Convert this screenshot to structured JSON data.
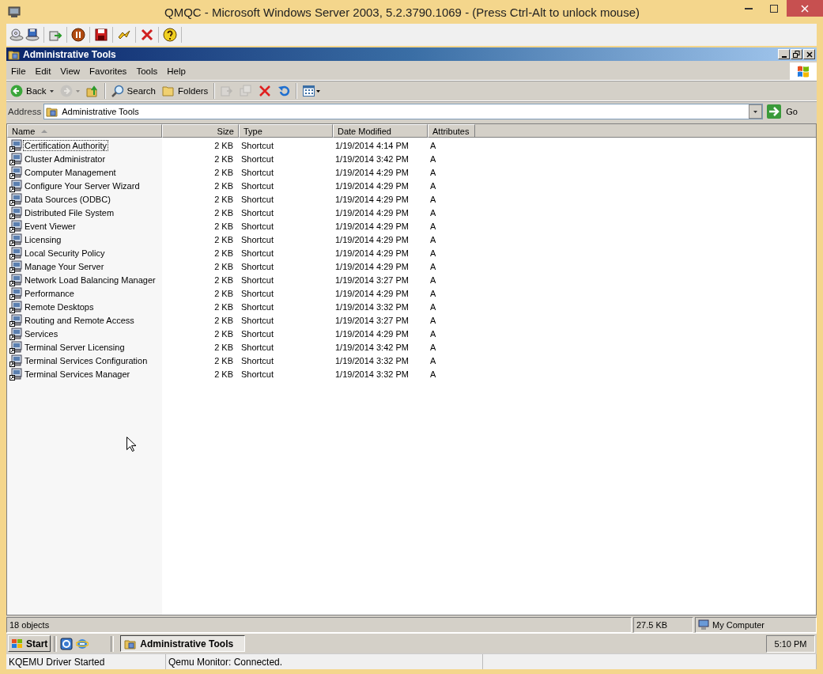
{
  "host_window": {
    "title": "QMQC - Microsoft Windows Server 2003, 5.2.3790.1069 - (Press Ctrl-Alt to unlock mouse)"
  },
  "explorer": {
    "title": "Administrative Tools",
    "menu": [
      {
        "label": "File"
      },
      {
        "label": "Edit"
      },
      {
        "label": "View"
      },
      {
        "label": "Favorites"
      },
      {
        "label": "Tools"
      },
      {
        "label": "Help"
      }
    ],
    "toolbar": [
      {
        "kind": "back",
        "label": "Back",
        "disabled": false
      },
      {
        "kind": "forward",
        "disabled": true
      },
      {
        "kind": "up",
        "disabled": false
      },
      {
        "kind": "separator"
      },
      {
        "kind": "search",
        "label": "Search",
        "disabled": false
      },
      {
        "kind": "folders",
        "label": "Folders",
        "disabled": false
      },
      {
        "kind": "separator"
      },
      {
        "kind": "move",
        "disabled": true
      },
      {
        "kind": "copy",
        "disabled": true
      },
      {
        "kind": "delete",
        "disabled": false
      },
      {
        "kind": "undo",
        "disabled": false
      },
      {
        "kind": "separator"
      },
      {
        "kind": "views",
        "disabled": false
      }
    ],
    "address": {
      "label": "Address",
      "value": "Administrative Tools",
      "go": "Go"
    },
    "columns": [
      {
        "label": "Name",
        "sorted": true
      },
      {
        "label": "Size",
        "sorted": false
      },
      {
        "label": "Type",
        "sorted": false
      },
      {
        "label": "Date Modified",
        "sorted": false
      },
      {
        "label": "Attributes",
        "sorted": false
      }
    ],
    "rows": [
      {
        "name": "Certification Authority",
        "size": "2 KB",
        "type": "Shortcut",
        "date": "1/19/2014 4:14 PM",
        "attributes": "A",
        "focused": true
      },
      {
        "name": "Cluster Administrator",
        "size": "2 KB",
        "type": "Shortcut",
        "date": "1/19/2014 3:42 PM",
        "attributes": "A",
        "focused": false
      },
      {
        "name": "Computer Management",
        "size": "2 KB",
        "type": "Shortcut",
        "date": "1/19/2014 4:29 PM",
        "attributes": "A",
        "focused": false
      },
      {
        "name": "Configure Your Server Wizard",
        "size": "2 KB",
        "type": "Shortcut",
        "date": "1/19/2014 4:29 PM",
        "attributes": "A",
        "focused": false
      },
      {
        "name": "Data Sources (ODBC)",
        "size": "2 KB",
        "type": "Shortcut",
        "date": "1/19/2014 4:29 PM",
        "attributes": "A",
        "focused": false
      },
      {
        "name": "Distributed File System",
        "size": "2 KB",
        "type": "Shortcut",
        "date": "1/19/2014 4:29 PM",
        "attributes": "A",
        "focused": false
      },
      {
        "name": "Event Viewer",
        "size": "2 KB",
        "type": "Shortcut",
        "date": "1/19/2014 4:29 PM",
        "attributes": "A",
        "focused": false
      },
      {
        "name": "Licensing",
        "size": "2 KB",
        "type": "Shortcut",
        "date": "1/19/2014 4:29 PM",
        "attributes": "A",
        "focused": false
      },
      {
        "name": "Local Security Policy",
        "size": "2 KB",
        "type": "Shortcut",
        "date": "1/19/2014 4:29 PM",
        "attributes": "A",
        "focused": false
      },
      {
        "name": "Manage Your Server",
        "size": "2 KB",
        "type": "Shortcut",
        "date": "1/19/2014 4:29 PM",
        "attributes": "A",
        "focused": false
      },
      {
        "name": "Network Load Balancing Manager",
        "size": "2 KB",
        "type": "Shortcut",
        "date": "1/19/2014 3:27 PM",
        "attributes": "A",
        "focused": false
      },
      {
        "name": "Performance",
        "size": "2 KB",
        "type": "Shortcut",
        "date": "1/19/2014 4:29 PM",
        "attributes": "A",
        "focused": false
      },
      {
        "name": "Remote Desktops",
        "size": "2 KB",
        "type": "Shortcut",
        "date": "1/19/2014 3:32 PM",
        "attributes": "A",
        "focused": false
      },
      {
        "name": "Routing and Remote Access",
        "size": "2 KB",
        "type": "Shortcut",
        "date": "1/19/2014 3:27 PM",
        "attributes": "A",
        "focused": false
      },
      {
        "name": "Services",
        "size": "2 KB",
        "type": "Shortcut",
        "date": "1/19/2014 4:29 PM",
        "attributes": "A",
        "focused": false
      },
      {
        "name": "Terminal Server Licensing",
        "size": "2 KB",
        "type": "Shortcut",
        "date": "1/19/2014 3:42 PM",
        "attributes": "A",
        "focused": false
      },
      {
        "name": "Terminal Services Configuration",
        "size": "2 KB",
        "type": "Shortcut",
        "date": "1/19/2014 3:32 PM",
        "attributes": "A",
        "focused": false
      },
      {
        "name": "Terminal Services Manager",
        "size": "2 KB",
        "type": "Shortcut",
        "date": "1/19/2014 3:32 PM",
        "attributes": "A",
        "focused": false
      }
    ],
    "status_bar": {
      "objects": "18 objects",
      "size": "27.5 KB",
      "zone": "My Computer"
    }
  },
  "taskbar": {
    "start": "Start",
    "tasks": [
      {
        "label": "Administrative Tools",
        "selected": true
      }
    ],
    "clock": "5:10 PM"
  },
  "qemu_status": {
    "left": "KQEMU Driver Started",
    "middle": "Qemu Monitor: Connected."
  }
}
